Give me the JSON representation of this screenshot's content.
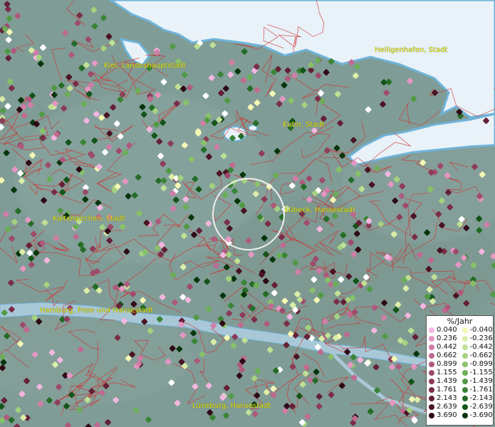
{
  "places": [
    {
      "id": "kiel",
      "name": "Kiel, Landeshauptstadt"
    },
    {
      "id": "heiligenhafen",
      "name": "Heiligenhafen, Stadt"
    },
    {
      "id": "eutin",
      "name": "Eutin, Stadt"
    },
    {
      "id": "luebeck",
      "name": "Lübeck, Hansestadt"
    },
    {
      "id": "kaltenkirchen",
      "name": "Kaltenkirchen, Stadt"
    },
    {
      "id": "hamburg",
      "name": "Hamburg, Freie und Hansestadt"
    },
    {
      "id": "lueneburg",
      "name": "Lüneburg, Hansestadt"
    }
  ],
  "legend": {
    "title": "%/Jahr",
    "rows": [
      {
        "pos": "0.040",
        "pos_color": "#f4b6e0",
        "neg": "-0.040",
        "neg_color": "#f4f7b4"
      },
      {
        "pos": "0.236",
        "pos_color": "#e596c3",
        "neg": "-0.236",
        "neg_color": "#dbeea7"
      },
      {
        "pos": "0.442",
        "pos_color": "#d07ea8",
        "neg": "-0.442",
        "neg_color": "#bfe095"
      },
      {
        "pos": "0.662",
        "pos_color": "#bf6a91",
        "neg": "-0.662",
        "neg_color": "#a4d27f"
      },
      {
        "pos": "0.899",
        "pos_color": "#ad5a7d",
        "neg": "-0.899",
        "neg_color": "#88c16a"
      },
      {
        "pos": "1.155",
        "pos_color": "#9d4b6b",
        "neg": "-1.155",
        "neg_color": "#6cae57"
      },
      {
        "pos": "1.439",
        "pos_color": "#8c3c59",
        "neg": "-1.439",
        "neg_color": "#519a45"
      },
      {
        "pos": "1.761",
        "pos_color": "#7a2d48",
        "neg": "-1.761",
        "neg_color": "#3a8436"
      },
      {
        "pos": "2.143",
        "pos_color": "#642036",
        "neg": "-2.143",
        "neg_color": "#246c27"
      },
      {
        "pos": "2.639",
        "pos_color": "#4a1425",
        "neg": "-2.639",
        "neg_color": "#135418"
      },
      {
        "pos": "3.690",
        "pos_color": "#2e0a16",
        "neg": "-3.690",
        "neg_color": "#07360d"
      }
    ]
  },
  "colors": {
    "land": "#809c96",
    "water": "#e8f2f8",
    "river": "#a9c8d7",
    "boundary": "#d03030",
    "label": "#e8e400",
    "white_point": "#ffffff"
  }
}
